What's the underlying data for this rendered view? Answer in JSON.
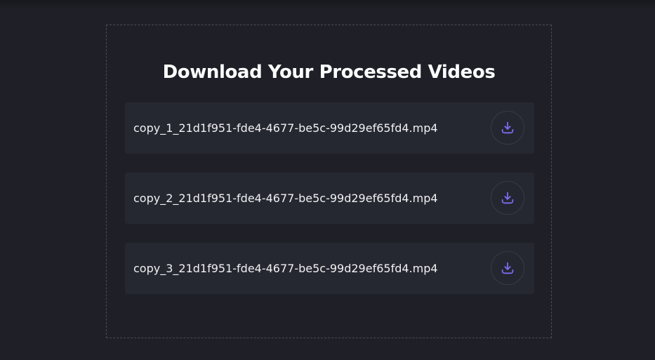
{
  "page": {
    "title": "Download Your Processed Videos"
  },
  "colors": {
    "background": "#1f2027",
    "row_background": "#262831",
    "accent": "#7b6cf0",
    "text": "#ffffff"
  },
  "files": [
    {
      "name": "copy_1_21d1f951-fde4-4677-be5c-99d29ef65fd4.mp4",
      "icon": "download-icon"
    },
    {
      "name": "copy_2_21d1f951-fde4-4677-be5c-99d29ef65fd4.mp4",
      "icon": "download-icon"
    },
    {
      "name": "copy_3_21d1f951-fde4-4677-be5c-99d29ef65fd4.mp4",
      "icon": "download-icon"
    }
  ]
}
